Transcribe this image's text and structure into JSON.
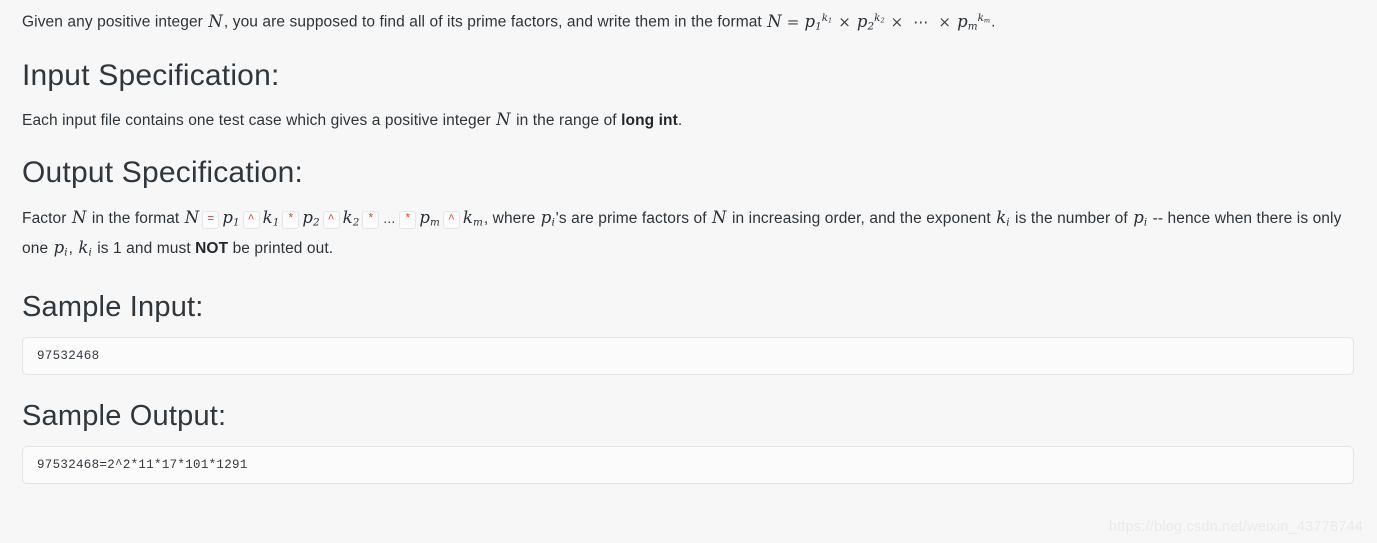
{
  "page": {
    "background_color": "#f7f7f8",
    "text_color": "#2f3438",
    "code_text_color": "#d6433b",
    "code_bg_color": "#fbfbfc",
    "code_border_color": "#e3e4e6"
  },
  "intro": {
    "text_before_var": "Given any positive integer ",
    "var_n": "N",
    "text_after_var": ", you are supposed to find all of its prime factors, and write them in the format ",
    "formula": {
      "lhs": "N",
      "equals": "=",
      "terms": [
        {
          "base": "p",
          "base_sub": "1",
          "exp": "k",
          "exp_sub": "1"
        },
        {
          "base": "p",
          "base_sub": "2",
          "exp": "k",
          "exp_sub": "2"
        }
      ],
      "times": "×",
      "cdots": "⋯",
      "last_term": {
        "base": "p",
        "base_sub": "m",
        "exp": "k",
        "exp_sub": "m"
      }
    },
    "period": "."
  },
  "input_spec": {
    "heading": "Input Specification:",
    "text_1": "Each input file contains one test case which gives a positive integer ",
    "var_n": "N",
    "text_2": " in the range of ",
    "bold_type": "long int",
    "text_3": "."
  },
  "output_spec": {
    "heading": "Output Specification:",
    "line1": {
      "t1": "Factor ",
      "var_n1": "N",
      "t2": " in the format ",
      "var_n2": "N",
      "code_eq": "=",
      "p1": {
        "base": "p",
        "sub": "1"
      },
      "code_caret_1": "^",
      "k1": {
        "base": "k",
        "sub": "1"
      },
      "code_star_1": "*",
      "p2": {
        "base": "p",
        "sub": "2"
      },
      "code_caret_2": "^",
      "k2": {
        "base": "k",
        "sub": "2"
      },
      "code_star_2": "*",
      "ellipsis": "...",
      "code_star_3": "*",
      "pm": {
        "base": "p",
        "sub": "m"
      },
      "code_caret_3": "^",
      "km": {
        "base": "k",
        "sub": "m"
      },
      "t3": ", where ",
      "pi": {
        "base": "p",
        "sub": "i"
      },
      "t4": "'s are prime factors of ",
      "var_n3": "N",
      "t5": " in increasing order, and the exponent ",
      "ki": {
        "base": "k",
        "sub": "i"
      },
      "t6": " is the number of ",
      "pi2": {
        "base": "p",
        "sub": "i"
      },
      "t7": " -- hence"
    },
    "line2": {
      "t1": "when there is only one ",
      "pi": {
        "base": "p",
        "sub": "i"
      },
      "t2": ", ",
      "ki": {
        "base": "k",
        "sub": "i"
      },
      "t3": " is 1 and must ",
      "bold_not": "NOT",
      "t4": " be printed out."
    }
  },
  "sample_input": {
    "heading": "Sample Input:",
    "code": "97532468"
  },
  "sample_output": {
    "heading": "Sample Output:",
    "code": "97532468=2^2*11*17*101*1291"
  },
  "watermark": {
    "text": "https://blog.csdn.net/weixin_43778744"
  }
}
